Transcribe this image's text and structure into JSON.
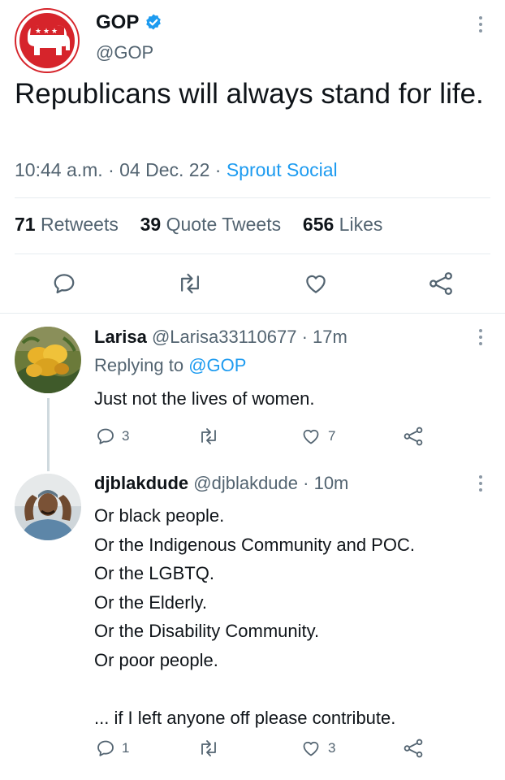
{
  "main_tweet": {
    "display_name": "GOP",
    "handle": "@GOP",
    "text": "Republicans will always stand for life.",
    "time": "10:44 a.m.",
    "date": "04 Dec. 22",
    "source": "Sprout Social",
    "separator": "·",
    "stats": {
      "retweets_count": "71",
      "retweets_label": "Retweets",
      "quotes_count": "39",
      "quotes_label": "Quote Tweets",
      "likes_count": "656",
      "likes_label": "Likes"
    }
  },
  "replies": [
    {
      "display_name": "Larisa",
      "handle": "@Larisa33110677",
      "time": "· 17m",
      "replying_prefix": "Replying to",
      "replying_to": "@GOP",
      "text": "Just not the lives of women.",
      "reply_count": "3",
      "retweet_count": "",
      "like_count": "7"
    },
    {
      "display_name": "djblakdude",
      "handle": "@djblakdude",
      "time": "· 10m",
      "lines": [
        "Or black people.",
        "Or the Indigenous Community and POC.",
        "Or the LGBTQ.",
        "Or the Elderly.",
        "Or the Disability Community.",
        "Or poor people.",
        "",
        "... if I left anyone off please contribute."
      ],
      "reply_count": "1",
      "retweet_count": "",
      "like_count": "3"
    }
  ],
  "colors": {
    "accent": "#1d9bf0",
    "gop_red": "#d6242b",
    "text": "#0f1419",
    "secondary": "#536471"
  },
  "icons": [
    "gop-logo-icon",
    "verified-badge-icon",
    "more-icon",
    "reply-icon",
    "retweet-icon",
    "like-icon",
    "share-icon"
  ]
}
